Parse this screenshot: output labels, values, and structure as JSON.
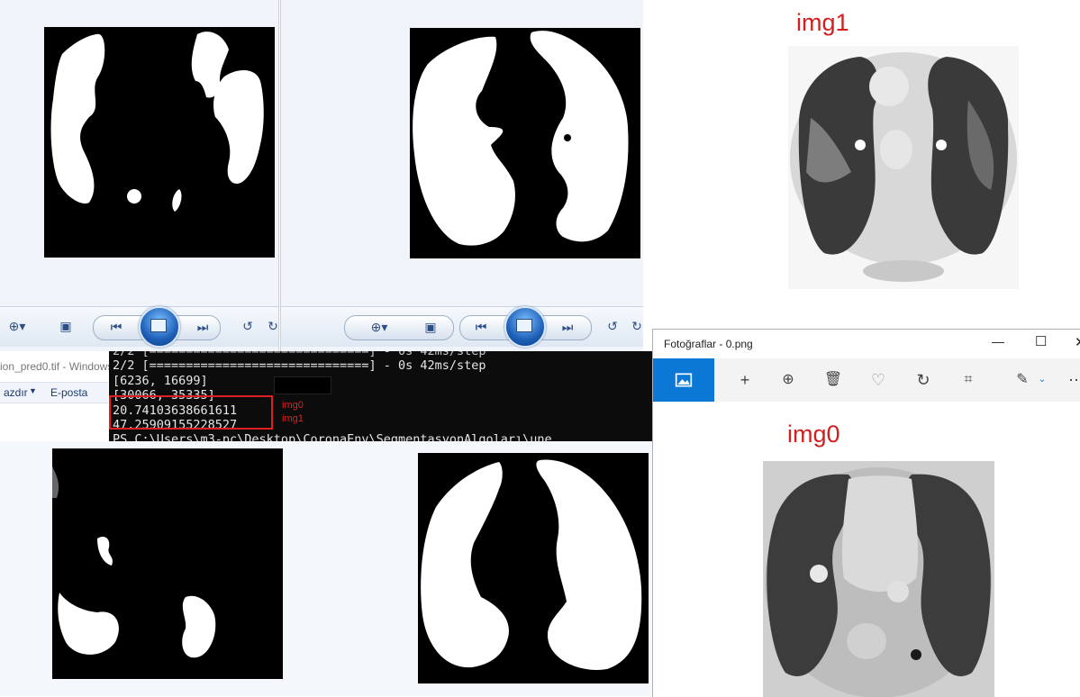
{
  "left_viewer": {
    "window_title": "ion_pred0.tif - Windows",
    "menu": {
      "print": "azdır",
      "email": "E-posta"
    }
  },
  "terminal": {
    "lines": [
      "2/2 [==============================] - 0s 42ms/step",
      "2/2 [==============================] - 0s 42ms/step",
      "[6236, 16699]",
      "[30066, 35335]",
      "20.74103638661611",
      "47.25909155228527",
      "PS C:\\Users\\m3-pc\\Desktop\\CoronaEnv\\SegmentasyonAlgoları\\une"
    ],
    "annotations": {
      "first": "img0",
      "second": "img1"
    }
  },
  "labels": {
    "top": "img1",
    "bottom": "img0"
  },
  "photos_app": {
    "title": "Fotoğraflar - 0.png",
    "window_controls": [
      "—",
      "☐",
      "✕"
    ],
    "commands": [
      "image-icon",
      "plus-icon",
      "zoom-icon",
      "delete-icon",
      "heart-icon",
      "rotate-icon",
      "crop-icon",
      "edit-icon",
      "more-icon"
    ]
  },
  "colors": {
    "annotation_red": "#e02020",
    "terminal_bg": "#0c0c0c",
    "photos_accent": "#0a78d4"
  }
}
